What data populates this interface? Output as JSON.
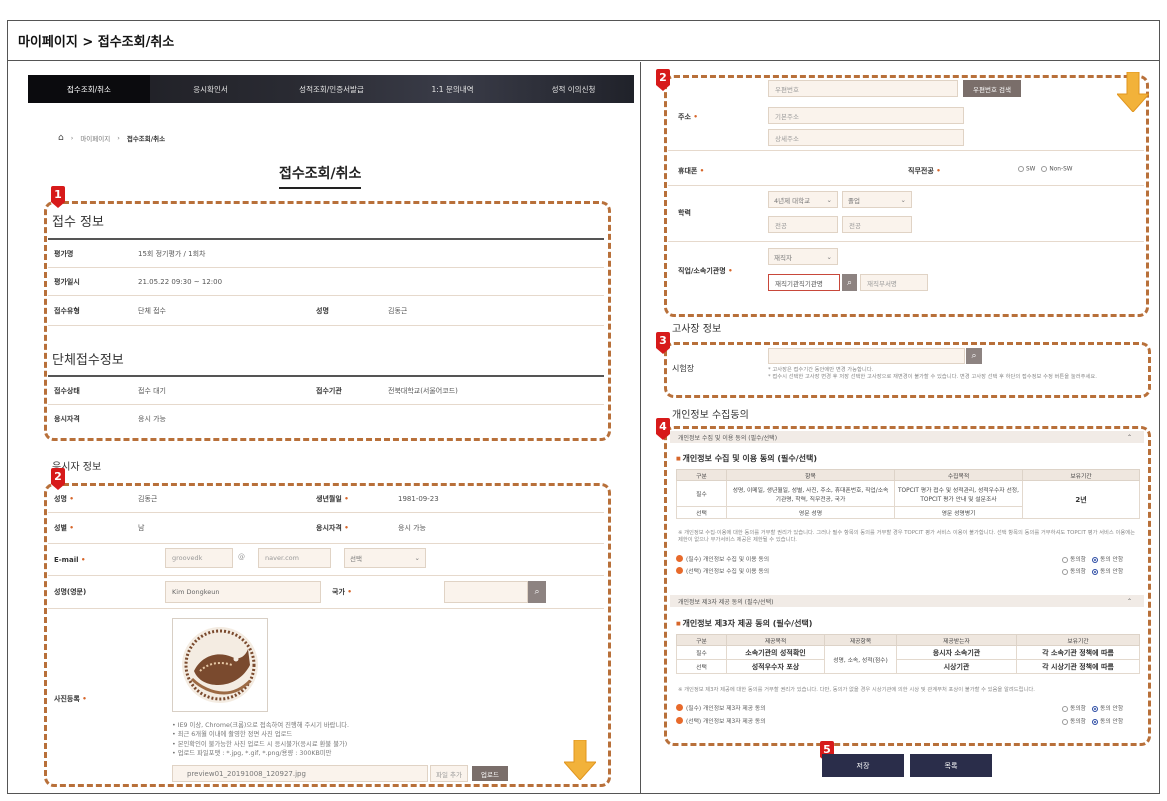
{
  "header": {
    "title": "마이페이지 > 접수조회/취소"
  },
  "nav": {
    "items": [
      {
        "label": "접수조회/취소",
        "active": true
      },
      {
        "label": "응시확인서"
      },
      {
        "label": "성적조회/인증서발급"
      },
      {
        "label": "1:1 문의내역"
      },
      {
        "label": "성적 이의신청"
      }
    ]
  },
  "breadcrumb": {
    "level1": "마이페이지",
    "level2": "접수조회/취소"
  },
  "page_title": "접수조회/취소",
  "badges": {
    "b1": "1",
    "b2": "2",
    "b3": "3",
    "b4": "4",
    "b5": "5"
  },
  "reception": {
    "title": "접수 정보",
    "exam_name_label": "평가명",
    "exam_name": "15회 정기평가 / 1회차",
    "exam_date_label": "평가일시",
    "exam_date": "21.05.22 09:30 ~ 12:00",
    "type_label": "접수유형",
    "type": "단체 접수",
    "name_label": "성명",
    "name": "김동근"
  },
  "group": {
    "title": "단체접수정보",
    "status_label": "접수상태",
    "status": "접수 대기",
    "org_label": "접수기관",
    "org": "전북대학교(서울어코드)",
    "qual_label": "응시자격",
    "qual": "응시 가능"
  },
  "applicant": {
    "title": "응시자 정보",
    "name_label": "성명",
    "name": "김동근",
    "birth_label": "생년월일",
    "birth": "1981-09-23",
    "gender_label": "성별",
    "gender": "남",
    "qual_label": "응시자격",
    "qual": "응시 가능",
    "email_label": "E-mail",
    "email_id": "groovedk",
    "at": "@",
    "email_domain": "naver.com",
    "email_select": "선택",
    "eng_name_label": "성명(영문)",
    "eng_name": "Kim Dongkeun",
    "country_label": "국가",
    "photo_label": "사진등록",
    "photo_notes": [
      "• IE9 이상, Chrome(크롬)으로 접속하여 진행해 주시기 바랍니다.",
      "• 최근 6개월 이내에 촬영한 정면 사진 업로드",
      "• 본인확인이 불가능한 사진 업로드 시 응시불가(응시료 환불 불가)",
      "• 업로드 파일포맷 : *.jpg, *.gif, *.png/용량 : 300KB미만"
    ],
    "file_name": "preview01_20191008_120927.jpg",
    "file_add": "파일 추가",
    "upload": "업로드"
  },
  "applicant2": {
    "zip_placeholder": "우편번호",
    "zip_button": "우편번호 검색",
    "address_label": "주소",
    "addr1_placeholder": "기본주소",
    "addr2_placeholder": "상세주소",
    "mobile_label": "휴대폰",
    "job_label": "직무전공",
    "sw": "SW",
    "nonsw": "Non-SW",
    "edu_label": "학력",
    "edu_select1": "4년제 대학교",
    "edu_select2": "졸업",
    "major1": "전공",
    "major2": "전공",
    "work_label": "직업/소속기관명",
    "work_select": "재직자",
    "org_input": "재직기관직기관명",
    "dept_placeholder": "재직부서명"
  },
  "exam_site": {
    "title": "고사장 정보",
    "label": "시험장",
    "note1": "* 고사장은 접수기간 동안에만 변경 가능합니다.",
    "note2": "* 접수시 선택한 고사장 변경 후 저장 선택한 고사장으로 재변경이 불가할 수 있습니다. 변경 고사장 선택 후 하단의 접수정보 수정 버튼을 눌러주세요."
  },
  "consent": {
    "title": "개인정보 수집동의",
    "head1": "개인정보 수집 및 이용 동의 (필수/선택)",
    "title1": "개인정보 수집 및 이용 동의 (필수/선택)",
    "t1_headers": [
      "구분",
      "항목",
      "수집목적",
      "보유기간"
    ],
    "t1_row1": [
      "필수",
      "성명, 이메일, 생년월일, 성별, 사진, 주소, 휴대폰번호, 직업/소속기관명, 학력, 직무전공, 국가",
      "TOPCIT 평가 접수 및 성적관리, 성적우수자 선정, TOPCIT 평가 안내 및 설문조사",
      "2년"
    ],
    "t1_row2": [
      "선택",
      "영문 성명",
      "영문 성명병기",
      ""
    ],
    "note1": "※ 개인정보 수집·이용에 대한 동의를 거부할 권리가 있습니다. 그러나 필수 항목의 동의를 거부할 경우 TOPCIT 평가 서비스 이용이 불가합니다. 선택 항목의 동의를 거부하셔도 TOPCIT 평가 서비스 이용에는 제한이 없으나 부가서비스 제공은 제한될 수 있습니다.",
    "c1": "(필수) 개인정보 수집 및 이용 동의",
    "c2": "(선택) 개인정보 수집 및 이용 동의",
    "agree": "동의함",
    "disagree": "동의 안함",
    "head2": "개인정보 제3자 제공 동의 (필수/선택)",
    "title2": "개인정보 제3자 제공 동의 (필수/선택)",
    "t2_headers": [
      "구분",
      "제공목적",
      "제공항목",
      "제공받는자",
      "보유기간"
    ],
    "t2_row1": [
      "필수",
      "소속기관의 성적확인",
      "성명, 소속, 성적(점수)",
      "응시자 소속기관",
      "각 소속기관 정책에 따름"
    ],
    "t2_row2": [
      "선택",
      "성적우수자 포상",
      "",
      "시상기관",
      "각 시상기관 정책에 따름"
    ],
    "note2": "※ 개인정보 제3자 제공에 대한 동의를 거부할 권리가 있습니다. 다만, 동의가 없을 경우 시상기관에 의한 시상 및 관계부처 포상이 불가할 수 있음을 알려드립니다.",
    "c3": "(필수) 개인정보 제3자 제공 동의",
    "c4": "(선택) 개인정보 제3자 제공 동의"
  },
  "buttons": {
    "save": "저장",
    "list": "목록"
  },
  "colors": {
    "dash": "#b8703a",
    "badge": "#d71a1a",
    "arrow": "#f2b23a",
    "navy": "#2a2d4a"
  }
}
